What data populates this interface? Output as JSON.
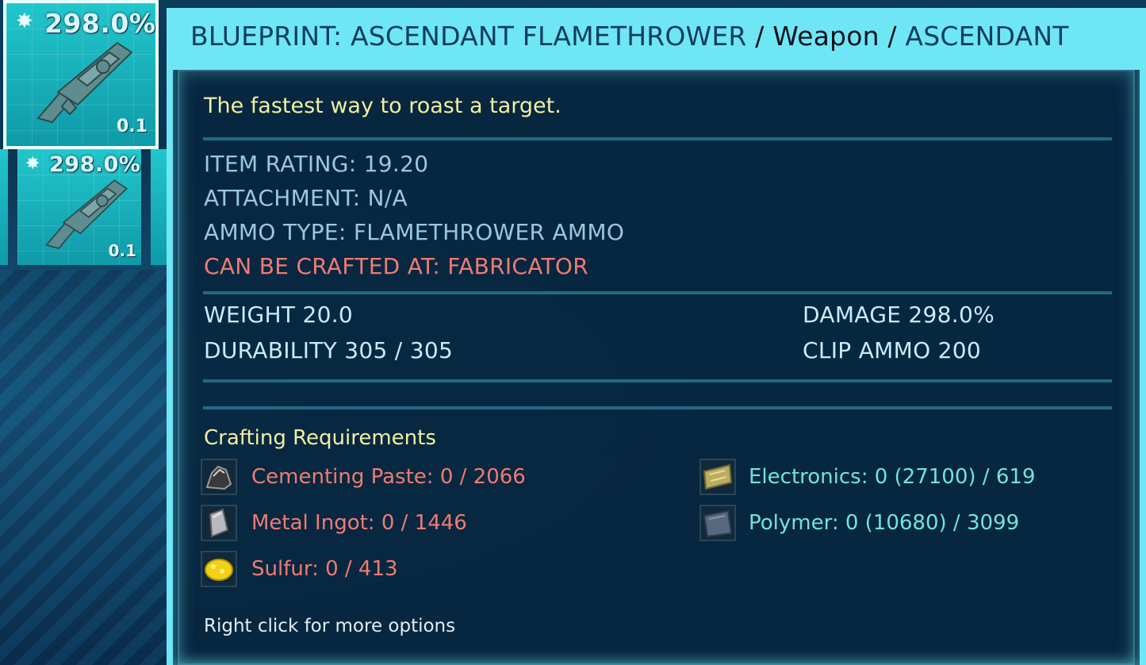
{
  "inventory": {
    "selected_slot": {
      "damage": "298.0%",
      "weight": "0.1"
    },
    "second_slot": {
      "damage": "298.0%",
      "weight": "0.1"
    }
  },
  "tooltip": {
    "title": {
      "name": "BLUEPRINT: ASCENDANT FLAMETHROWER",
      "sep1": " / ",
      "type": "Weapon",
      "sep2": " / ",
      "quality": "ASCENDANT"
    },
    "description": "The fastest way to roast a target.",
    "info": {
      "item_rating": "ITEM RATING: 19.20",
      "attachment": "ATTACHMENT: N/A",
      "ammo_type": "AMMO TYPE: FLAMETHROWER AMMO",
      "crafted_at": "CAN BE CRAFTED AT: FABRICATOR"
    },
    "stats": {
      "weight": "WEIGHT 20.0",
      "durability": "DURABILITY 305 / 305",
      "damage": "DAMAGE 298.0%",
      "clip_ammo": "CLIP AMMO 200"
    },
    "requirements_title": "Crafting Requirements",
    "requirements_left": [
      {
        "text": "Cementing Paste: 0 / 2066",
        "icon": "cementing-paste-icon"
      },
      {
        "text": "Metal Ingot: 0 / 1446",
        "icon": "metal-ingot-icon"
      },
      {
        "text": "Sulfur: 0 / 413",
        "icon": "sulfur-icon"
      }
    ],
    "requirements_right": [
      {
        "text": "Electronics: 0 (27100) / 619",
        "icon": "electronics-icon"
      },
      {
        "text": "Polymer: 0 (10680) / 3099",
        "icon": "polymer-icon"
      }
    ],
    "footer": "Right click for more options"
  },
  "colors": {
    "accent": "#6fe6f6",
    "missing": "#f07b72",
    "available": "#6fe6d8",
    "highlight": "#f1efa0"
  }
}
